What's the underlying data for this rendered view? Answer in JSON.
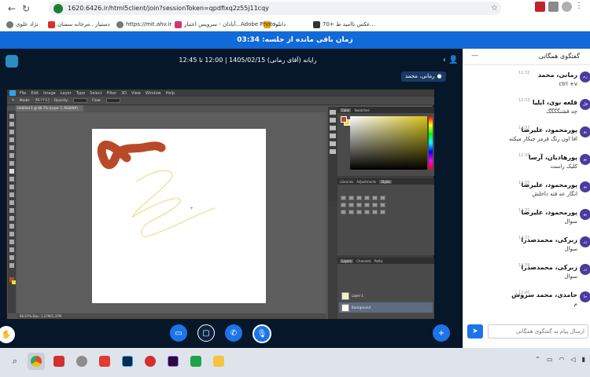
{
  "browser": {
    "url": "1620.6426.ir/html5client/join?sessionToken=qpdfixq2z55j11cqy",
    "bookmarks": [
      "70+ عکس ناامید ط...",
      "دانلود",
      "Adobe Photo...",
      "آبادان - سرویس اعتبار...",
      "https://mit.ahv.ir",
      "دستیار ..مرجانه سمنان",
      "نژاد علوی"
    ]
  },
  "timer": {
    "text": "زمان باقی مانده از جلسه: 03:34"
  },
  "meeting": {
    "title": "رایانه (آقای رمانی) 1405/02/15 | 12:00 تا 12:45",
    "presenter": "رمانی، محمد"
  },
  "photoshop": {
    "menu": [
      "File",
      "Edit",
      "Image",
      "Layer",
      "Type",
      "Select",
      "Filter",
      "3D",
      "View",
      "Window",
      "Help"
    ],
    "options": [
      "Mode:",
      "Normal",
      "Opacity:",
      "Flow:"
    ],
    "doc_tab": "Untitled-1 @ 66.7% (Layer 1, RGB/8#)",
    "status": "66.67%    Doc: 1.37M/1.37M",
    "panels": {
      "color_tabs": [
        "Color",
        "Swatches"
      ],
      "style_tabs": [
        "Libraries",
        "Adjustments",
        "Styles"
      ],
      "layer_tabs": [
        "Layers",
        "Channels",
        "Paths"
      ],
      "layers": [
        "Layer 1",
        "Background"
      ]
    },
    "colors": {
      "foreground": "#b84a2a",
      "background": "#e6dc3a"
    }
  },
  "chat": {
    "title": "گفتگوی همگانی",
    "input_placeholder": "ارسال پیام به گفتگوی همگانی",
    "messages": [
      {
        "avatar": "رم",
        "name": "رمانی، محمد",
        "time": "12:32",
        "text": "ctrl +v"
      },
      {
        "avatar": "قل",
        "name": "قلعه نوی، ایلیا",
        "time": "12:33",
        "text": "چه قشنگگگگ"
      },
      {
        "avatar": "پو",
        "name": "پورمحمود، علیرضا",
        "time": "12:33",
        "text": "اقا اون رنگ قرمز چیکار میکنه"
      },
      {
        "avatar": "پو",
        "name": "پورهادیان، آرسا",
        "time": "12:34",
        "text": "کلیک راست"
      },
      {
        "avatar": "پو",
        "name": "پورمحمود، علیرضا",
        "time": "12:35",
        "text": "انگار عه فته داخلش"
      },
      {
        "avatar": "پو",
        "name": "پورمحمود، علیرضا",
        "time": "12:35",
        "text": "سوال"
      },
      {
        "avatar": "زر",
        "name": "زبرکی، محمدصدرا",
        "time": "12:37",
        "text": "سوال"
      },
      {
        "avatar": "زر",
        "name": "زبرکی، محمدصدرا",
        "time": "12:39",
        "text": "سوال"
      },
      {
        "avatar": "حا",
        "name": "حامدی، محمد سروش",
        "time": "12:40",
        "text": "م"
      }
    ]
  },
  "icons": {
    "back": "arrow-left-icon",
    "reload": "reload-icon",
    "send": "send-icon",
    "mic": "microphone-icon",
    "call": "phone-icon",
    "screen": "screen-share-icon",
    "camera": "camera-icon",
    "plus": "plus-icon",
    "hand": "raise-hand-icon"
  }
}
